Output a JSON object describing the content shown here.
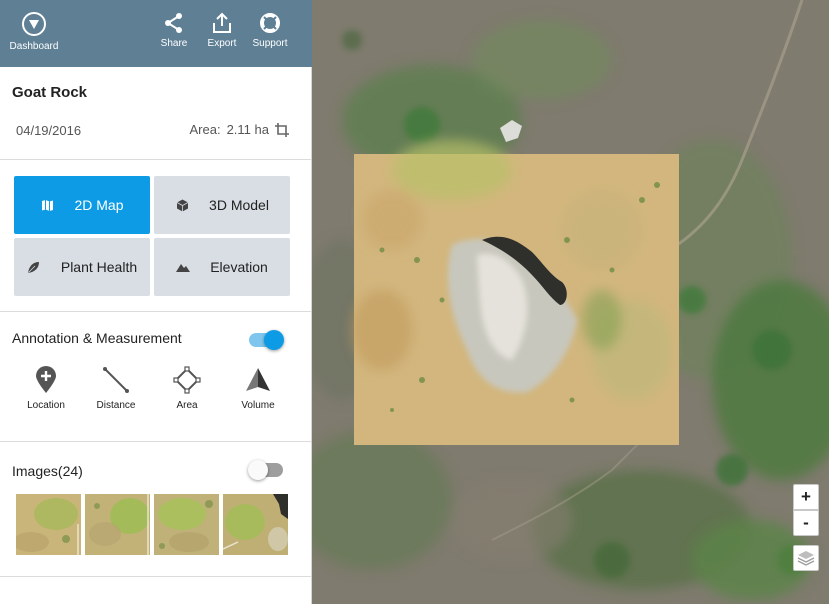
{
  "topbar": {
    "dashboard_label": "Dashboard",
    "share_label": "Share",
    "export_label": "Export",
    "support_label": "Support"
  },
  "project": {
    "title": "Goat Rock",
    "date": "04/19/2016",
    "area_label": "Area:",
    "area_value": "2.11 ha"
  },
  "view_modes": [
    {
      "label": "2D Map",
      "icon": "map-icon",
      "active": true
    },
    {
      "label": "3D Model",
      "icon": "cube-icon",
      "active": false
    },
    {
      "label": "Plant Health",
      "icon": "leaf-icon",
      "active": false
    },
    {
      "label": "Elevation",
      "icon": "mountain-icon",
      "active": false
    }
  ],
  "annotation": {
    "title": "Annotation & Measurement",
    "enabled": true,
    "tools": [
      {
        "label": "Location",
        "icon": "location-pin-icon"
      },
      {
        "label": "Distance",
        "icon": "distance-line-icon"
      },
      {
        "label": "Area",
        "icon": "area-polygon-icon"
      },
      {
        "label": "Volume",
        "icon": "volume-pyramid-icon"
      }
    ]
  },
  "images": {
    "title": "Images(24)",
    "enabled": false,
    "thumbnail_count_visible": 4
  },
  "map_controls": {
    "zoom_in": "+",
    "zoom_out": "-",
    "collapse": "‹"
  },
  "colors": {
    "header": "#5f7f95",
    "accent": "#0e9be5",
    "mode_button": "#d8dee3"
  }
}
